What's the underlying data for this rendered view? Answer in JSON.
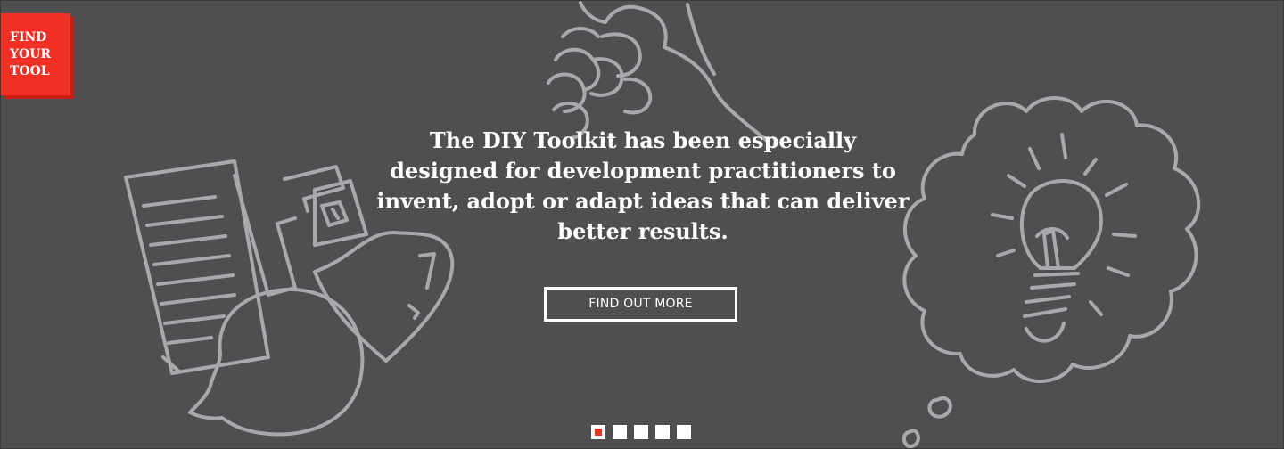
{
  "badge": {
    "lines": [
      "FIND",
      "YOUR",
      "TOOL"
    ]
  },
  "hero": {
    "headline": "The DIY Toolkit has been especially designed for development practitioners to invent, adopt or adapt ideas that can deliver better results.",
    "cta_label": "FIND OUT MORE"
  },
  "slider": {
    "slide_count": 5,
    "active_index": 0
  },
  "colors": {
    "background": "#4f4f51",
    "accent": "#ee3124",
    "doodle": "#a9a9ad",
    "text": "#ffffff"
  },
  "icons": [
    "document-doodle-icon",
    "wrench-doodle-icon",
    "speech-bubble-doodle-icon",
    "heart-doodle-icon",
    "fist-doodle-icon",
    "lightbulb-thought-doodle-icon"
  ]
}
